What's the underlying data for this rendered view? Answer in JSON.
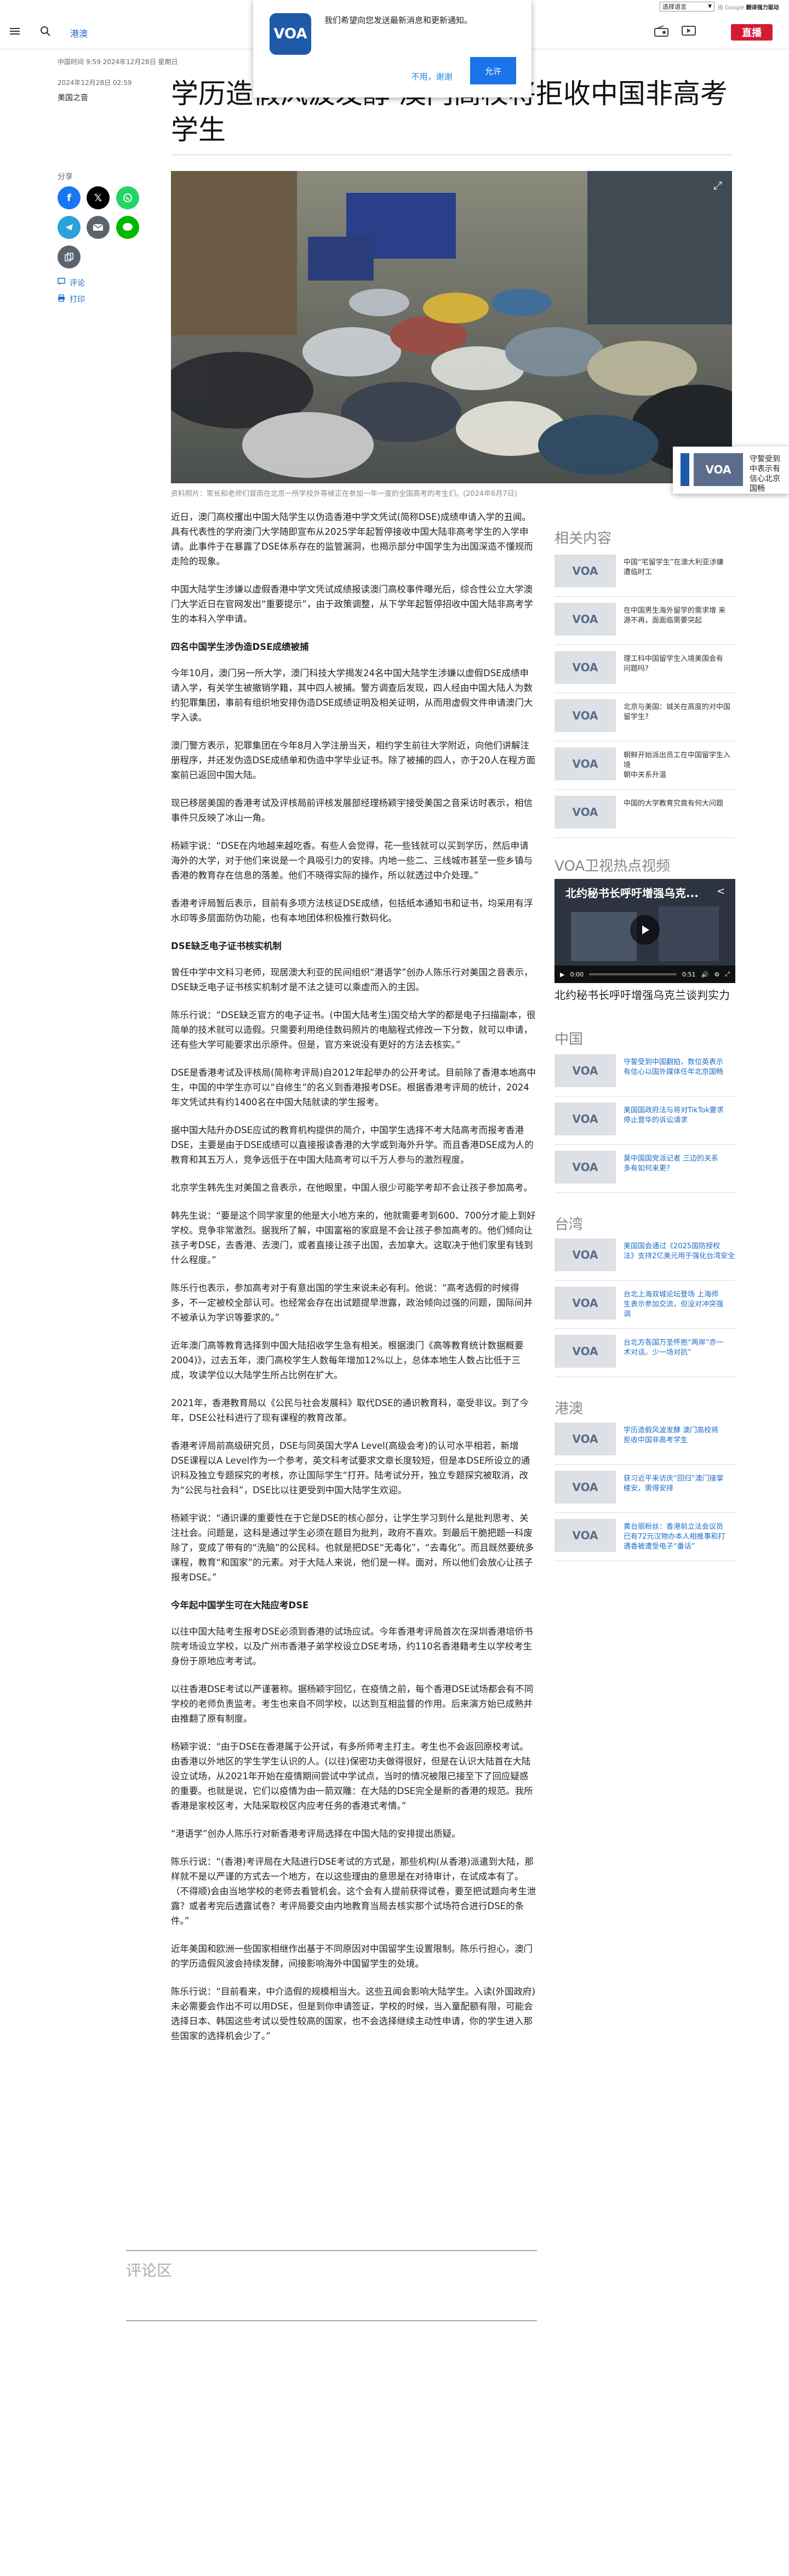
{
  "util": {
    "language_select": "选择语言",
    "google_prefix": "由 Google",
    "google_suffix": "翻译强力驱动"
  },
  "header": {
    "section": "港澳",
    "live_label": "直播"
  },
  "notification": {
    "logo": "VOA",
    "message": "我们希望向您发送最新消息和更新通知。",
    "decline_label": "不用，谢谢",
    "allow_label": "允许"
  },
  "article": {
    "updated": "中国时间 9:59 2024年12月28日 星期日",
    "published": "2024年12月28日 02:59",
    "byline": "美国之音",
    "title": "学历造假风波发酵 澳门高校将拒收中国非高考学生",
    "image_caption": "资料照片：家长和老师们冒雨在北京一所学校外等候正在参加一年一度的全国高考的考生们。(2024年6月7日)"
  },
  "share": {
    "label": "分享",
    "comment_label": "评论",
    "print_label": "打印"
  },
  "float_video": {
    "logo": "VOA",
    "text": "守誓受到中表示有信心北京国畅"
  },
  "body": [
    {
      "type": "p",
      "text": "近日，澳门高校攫出中国大陆学生以伪造香港中学文凭试(简称DSE)成绩申请入学的丑闻。具有代表性的学府澳门大学随即宣布从2025学年起暂停接收中国大陆非高考学生的入学申请。此事件于在暴露了DSE体系存在的监管漏洞，也揭示部分中国学生为出国深造不懂规而走险的现象。"
    },
    {
      "type": "p",
      "text": "中国大陆学生涉嫌以虚假香港中学文凭试成绩报读澳门高校事件曝光后，综合性公立大学澳门大学近日在官网发出“重要提示”，由于政策调整，从下学年起暂停招收中国大陆非高考学生的本科入学申请。"
    },
    {
      "type": "h",
      "text": "四名中国学生涉伪造DSE成绩被捕"
    },
    {
      "type": "p",
      "text": "今年10月，澳门另一所大学，澳门科技大学揭发24名中国大陆学生涉嫌以虚假DSE成绩申请入学，有关学生被撤销学籍，其中四人被捕。警方调查后发现，四人经由中国大陆人为数约犯罪集团，事前有组织地安排伪造DSE成绩证明及相关证明，从而用虚假文件申请澳门大学入读。"
    },
    {
      "type": "p",
      "text": "澳门警方表示，犯罪集团在今年8月入学注册当天，相约学生前往大学附近，向他们讲解注册程序，并还发伪造DSE成绩单和伪造中学毕业证书。除了被捕的四人，亦于20人在程方面案前已返回中国大陆。"
    },
    {
      "type": "p",
      "text": "现已移居美国的香港考试及评核局前评核发展部经理杨颖宇接受美国之音采访时表示，相信事件只反映了冰山一角。"
    },
    {
      "type": "p",
      "text": "杨颖宇说：“DSE在内地越来越吃香。有些人会觉得，花一些钱就可以买到学历，然后申请海外的大学，对于他们来说是一个具吸引力的安排。内地一些二、三线城市甚至一些乡镇与香港的教育存在信息的落差。他们不晓得实际的操作，所以就透过中介处理。”"
    },
    {
      "type": "p",
      "text": "香港考评局暂后表示，目前有多项方法核证DSE成绩，包括纸本通知书和证书，均采用有浮水印等多层面防伪功能，也有本地团体积极推行数码化。"
    },
    {
      "type": "h",
      "text": "DSE缺乏电子证书核实机制"
    },
    {
      "type": "p",
      "text": "曾任中学中文科习老师，现居澳大利亚的民间组织“港语学”创办人陈乐行对美国之音表示，DSE缺乏电子证书核实机制才是不法之徒可以乘虚而入的主因。"
    },
    {
      "type": "p",
      "text": "陈乐行说：“DSE缺乏官方的电子证书。(中国大陆考生)国交给大学的都是电子扫描副本，很简单的技术就可以造假。只需要利用绝佳数码照片的电脑程式修改一下分数，就可以申请，还有些大学可能要求出示原件。但是，官方来说没有更好的方法去核实。”"
    },
    {
      "type": "p",
      "text": "DSE是香港考试及评核局(简称考评局)自2012年起举办的公开考试。目前除了香港本地高中生，中国的中学生亦可以“自修生”的名义到香港报考DSE。根据香港考评局的统计，2024年文凭试共有约1400名在中国大陆就读的学生报考。"
    },
    {
      "type": "p",
      "text": "据中国大陆升办DSE应试的教育机构提供的简介，中国学生选择不考大陆高考而报考香港DSE，主要是由于DSE成绩可以直接报读香港的大学或到海外升学。而且香港DSE成为人的教育和其五万人，竞争远低于在中国大陆高考可以千万人参与的激烈程度。"
    },
    {
      "type": "p",
      "text": "北京学生韩先生对美国之音表示，在他眼里，中国人很少可能学考却不会让孩子参加高考。"
    },
    {
      "type": "p",
      "text": "韩先生说：“要是这个同学家里的他是大小地方来的，他就需要考到600、700分才能上到好学校。竞争非常激烈。据我所了解，中国富裕的家庭是不会让孩子参加高考的。他们倾向让孩子考DSE，去香港、去澳门，或者直接让孩子出国，去加拿大。这取决于他们家里有钱到什么程度。”"
    },
    {
      "type": "p",
      "text": "陈乐行也表示，参加高考对于有意出国的学生来说未必有利。他说：“高考选假的时候得多，不一定被校全部认可。也经常会存在出试题提早泄露，政治倾向过强的问题，国际间并不被承认为学识等要求的。”"
    },
    {
      "type": "p",
      "text": "近年澳门高等教育选择到中国大陆招收学生急有相关。根据澳门《高等教育统计数据概要2004)》，过去五年，澳门高校学生人数每年增加12%以上，总体本地生人数占比低于三成，攻读学位以大陆学生所占比例在扩大。"
    },
    {
      "type": "p",
      "text": "2021年，香港教育局以《公民与社会发展科》取代DSE的通识教育科，毫受非议。到了今年，DSE公社科进行了现有课程的教育改革。"
    },
    {
      "type": "p",
      "text": "香港考评局前高级研究员，DSE与同英国大学A Level(高级会考)的认可水平相若，新增DSE课程以A Level作为一个参考，英文科考试要求文章长度较短，但是本DSE所设立的通识科及独立专题探究的考核，亦让国际学生“打开。陆考试分开，独立专题探究被取消，改为“公民与社会科”，DSE比以往更受到中国大陆学生欢迎。"
    },
    {
      "type": "p",
      "text": "杨颖宇说：“通识课的重要性在于它是DSE的核心部分，让学生学习到什么是批判思考、关注社会。问题是，这科是通过学生必须在题目为批判，政府不喜欢。到最后干脆把题一科废除了，变成了带有的“洗脑”的公民科。也就是把DSE“无毒化”，“去毒化”。而且既然要统多课程，教育“和国家”的元素。对于大陆人来说，他们是一样。面对，所以他们会放心让孩子报考DSE。”"
    },
    {
      "type": "h",
      "text": "今年起中国学生可在大陆应考DSE"
    },
    {
      "type": "p",
      "text": "以往中国大陆考生报考DSE必须到香港的试场应试。今年香港考评局首次在深圳香港培侨书院考场设立学校，以及广州市香港子弟学校设立DSE考场，约110名香港籍考生以学校考生身份于原地应考考试。"
    },
    {
      "type": "p",
      "text": "以往香港DSE考试以严谨著称。据杨颖宇回忆，在疫情之前，每个香港DSE试场都会有不同学校的老师负责监考。考生也来自不同学校，以达到互相监督的作用。后来演方始已成熟并由推翻了原有制度。"
    },
    {
      "type": "p",
      "text": "杨颖宇说：“由于DSE在香港属于公开试，有多所师考主打主。考生也不会返回原校考试。由香港以外地区的学生学生认识的人。(以往)保密功夫做得很好，但是在认识大陆首在大陆设立试场，从2021年开始在疫情期间尝试中学试点，当时的情况被限已接至下了回应疑惑的重要。也就是说，它们以疫情为由一箭双雕：在大陆的DSE完全是新的香港的规范。我所香港是家校区考，大陆采取校区内应考任务的香港式考情。”"
    },
    {
      "type": "p",
      "text": "“港语学”创办人陈乐行对新香港考评局选择在中国大陆的安排提出质疑。"
    },
    {
      "type": "p",
      "text": "陈乐行说：“(香港)考评局在大陆进行DSE考试的方式是，那些机构(从香港)派遣到大陆，那样就不是以严谨的方式去一个地方，在以这些理由的意思是在对待审计，在试成本有了。（不得顺)会由当地学校的老师去看管机会。这个会有人提前获得试卷，要至把试题向考生泄露？或者考完后透露试卷？考评局要交由内地教育当局去核实那个试场符合进行DSE的条件。”"
    },
    {
      "type": "p",
      "text": "近年美国和欧洲一些国家相继作出基于不同原因对中国留学生设置限制。陈乐行担心，澳门的学历造假风波会持续发酵，间接影响海外中国留学生的处境。"
    },
    {
      "type": "p",
      "text": "陈乐行说：“目前看来，中介造假的规模相当大。这些丑闻会影响大陆学生。入读(外国政府)未必需要会作出不可以用DSE，但是到你申请签证，学校的时候，当入童配额有限，可能会选择日本、韩国这些考试以受性较高的国家，也不会选择继续主动性申请，你的学生进入那些国家的选择机会少了。”"
    }
  ],
  "comments": {
    "heading": "评论区"
  },
  "sidebar": {
    "related_heading": "相关内容",
    "related": [
      {
        "logo": "VOA",
        "text": "中国“宅留学生”在澳大利亚涉嫌\n遭临时工"
      },
      {
        "logo": "VOA",
        "text": "在中国男生海外留学的需求增 来\n源不再，面面临需要突起"
      },
      {
        "logo": "VOA",
        "text": "理工科中国留学生入境美国会有\n问题吗?"
      },
      {
        "logo": "VOA",
        "text": "北京与美国：城关在高度的对中国\n留学生?"
      },
      {
        "logo": "VOA",
        "text": "朝鲜开始派出员工在中国留学生入境\n朝中关系升温"
      },
      {
        "logo": "VOA",
        "text": "中国的大学教育究竟有何大问题"
      }
    ],
    "video_heading": "VOA卫视热点视频",
    "video_title": "北约秘书长呼吁增强乌克...",
    "video_time_start": "0:00",
    "video_time_end": "0:51",
    "video_progress": 0,
    "video_caption": "北约秘书长呼吁增强乌克兰谈判实力",
    "china_heading": "中国",
    "china": [
      {
        "logo": "VOA",
        "text": "守誓受到中国翻拍，数位英表示\n有信心以国外媒体任年北京国畅"
      },
      {
        "logo": "VOA",
        "text": "美国国政府法与将对TikTok要求\n停止营华的诉讼请求"
      },
      {
        "logo": "VOA",
        "text": "莫中国国党派记者 三边的关系\n多有如何来更?"
      }
    ],
    "taiwan_heading": "台湾",
    "taiwan": [
      {
        "logo": "VOA",
        "text": "美国国会通过《2025国防授权\n法》支持2亿美元用于强化台湾安全"
      },
      {
        "logo": "VOA",
        "text": "台北上海双城论坛登场 上海师\n生表示参加交流，但没对冲突强\n调"
      },
      {
        "logo": "VOA",
        "text": "台北方各国万圣怀抱“两岸”亦一\n术对话。少一场对抗”"
      }
    ],
    "hk_heading": "港澳",
    "hk": [
      {
        "logo": "VOA",
        "text": "学历造假风波发酵 澳门高校将\n拒收中国非高考学生"
      },
      {
        "logo": "VOA",
        "text": "获习近平来访庆“回归”澳门接掌\n楼安，需得安排"
      },
      {
        "logo": "VOA",
        "text": "黄台丽粉丝：香港前立法会议员\n已有72元汉物办本人相推事和打\n遇香被遭受电子“番话”"
      }
    ]
  },
  "colors": {
    "accent_blue": "#1d6cc8",
    "live_red": "#d51b30",
    "facebook": "#1877f2",
    "x": "#000000",
    "whatsapp": "#25d366",
    "telegram": "#2aa1da",
    "email": "#59646f",
    "line": "#00b900",
    "copy": "#59646f"
  }
}
